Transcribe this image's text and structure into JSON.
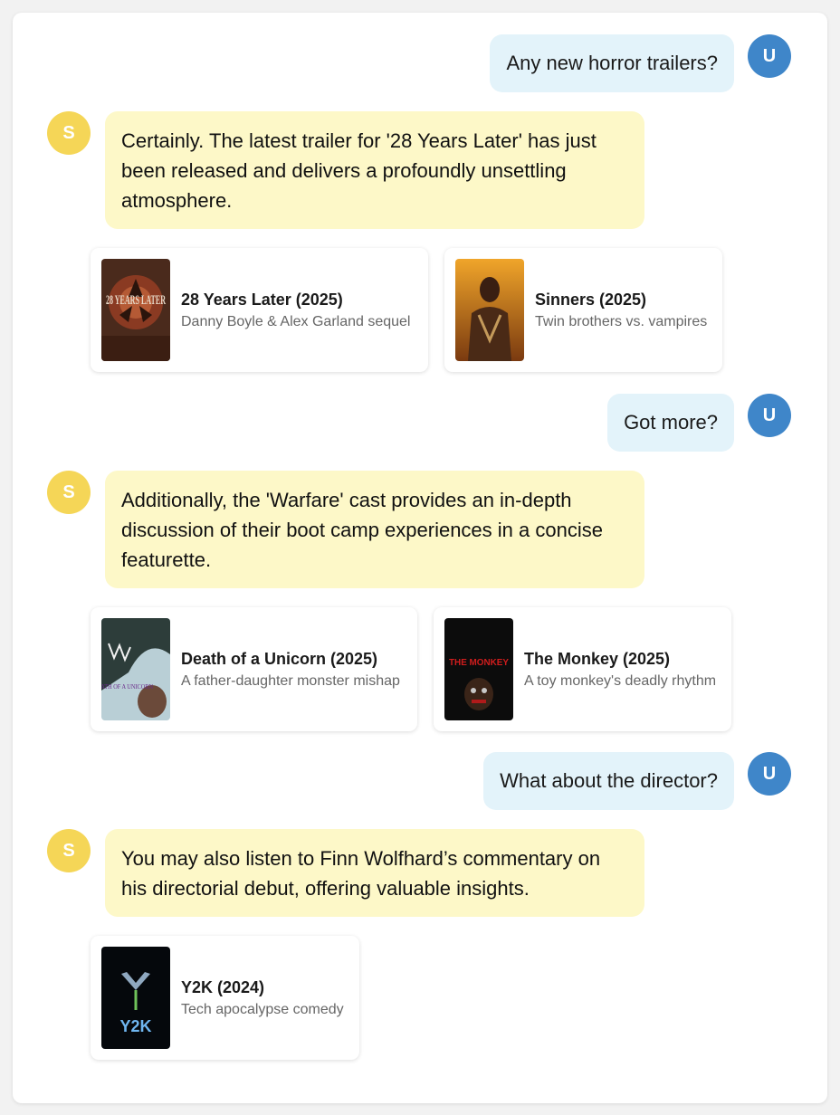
{
  "messages": {
    "u1": "Any new horror trailers?",
    "s1": "Certainly. The latest trailer for '28 Years Later' has just been released and delivers a profoundly unsettling atmosphere.",
    "u2": "Got more?",
    "s2": "Additionally, the 'Warfare' cast provides an in-depth discussion of their boot camp experiences in a concise featurette.",
    "u3": "What about the director?",
    "s3": "You may also listen to Finn Wolfhard’s commentary on his directorial debut, offering valuable insights."
  },
  "avatars": {
    "user": "U",
    "system": "S"
  },
  "cards": [
    {
      "title": "28 Years Later (2025)",
      "subtitle": "Danny Boyle & Alex Garland sequel"
    },
    {
      "title": "Sinners (2025)",
      "subtitle": "Twin brothers vs. vampires"
    },
    {
      "title": "Death of a Unicorn (2025)",
      "subtitle": "A father-daughter monster mishap"
    },
    {
      "title": "The Monkey (2025)",
      "subtitle": "A toy monkey's deadly rhythm"
    },
    {
      "title": "Y2K (2024)",
      "subtitle": "Tech apocalypse comedy"
    }
  ],
  "posters": {
    "p1": "28 YEARS LATER",
    "p3": "DEATH OF A UNICORN",
    "p4": "THE MONKEY",
    "p5": "Y2K"
  },
  "colors": {
    "user_avatar": "#3f86c9",
    "system_avatar": "#f5d657",
    "user_bubble": "#e3f3fa",
    "system_bubble": "#fdf8c8"
  }
}
